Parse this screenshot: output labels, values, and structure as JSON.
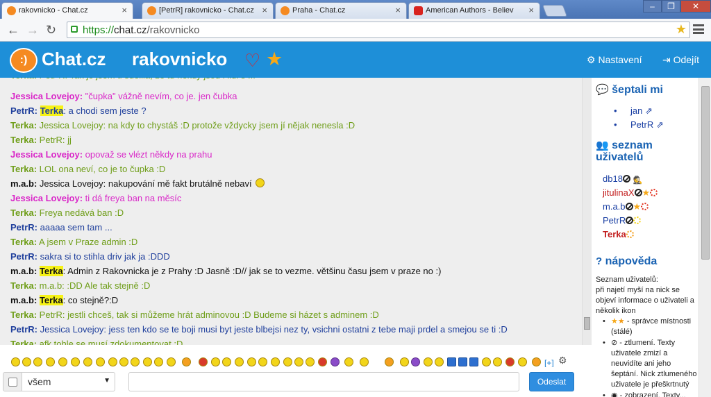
{
  "browser": {
    "tabs": [
      {
        "title": "rakovnicko - Chat.cz",
        "active": true,
        "icon": "chat-favicon"
      },
      {
        "title": "[PetrR] rakovnicko - Chat.cz",
        "active": false,
        "icon": "chat-favicon"
      },
      {
        "title": "Praha - Chat.cz",
        "active": false,
        "icon": "chat-favicon"
      },
      {
        "title": "American Authors - Believ",
        "active": false,
        "icon": "youtube-favicon"
      }
    ],
    "url_scheme": "https://",
    "url_host": "chat.cz",
    "url_path": "/rakovnicko"
  },
  "header": {
    "logo_text": "Chat.cz",
    "room_title": "rakovnicko",
    "settings_label": "Nastavení",
    "logout_label": "Odejít",
    "brand_color": "#1e8fd8"
  },
  "messages": [
    {
      "nick": "Terka:",
      "text": " Petr R: Tak je jsem ti sdělila, že tu někdy jsou i lidi s ... ",
      "color": "green",
      "partial": true
    },
    {
      "nick": "Jessica Lovejoy:",
      "text": " \"čupka\" vážně nevím, co je. jen čubka",
      "color": "pink"
    },
    {
      "nick": "PetrR:",
      "tag": "Terka",
      "text": ": a chodi sem jeste ?",
      "color": "blue"
    },
    {
      "nick": "Terka:",
      "text": " Jessica Lovejoy: na kdy to chystáš :D protože vždycky jsem jí nějak nenesla :D",
      "color": "green"
    },
    {
      "nick": "Terka:",
      "text": " PetrR: jj",
      "color": "green"
    },
    {
      "nick": "Jessica Lovejoy:",
      "text": " opovaž se vlézt někdy na prahu",
      "color": "pink"
    },
    {
      "nick": "Terka:",
      "text": " LOL ona neví, co je to čupka :D",
      "color": "green"
    },
    {
      "nick": "m.a.b:",
      "text": " Jessica Lovejoy: nakupování mě fakt brutálně nebaví ",
      "color": "black",
      "smiley": true
    },
    {
      "nick": "Jessica Lovejoy:",
      "text": " ti dá freya ban na měsíc",
      "color": "pink"
    },
    {
      "nick": "Terka:",
      "text": " Freya nedává ban :D",
      "color": "green"
    },
    {
      "nick": "PetrR:",
      "text": " aaaaa sem tam ...",
      "color": "blue"
    },
    {
      "nick": "Terka:",
      "text": " A jsem v Praze admin :D",
      "color": "green"
    },
    {
      "nick": "PetrR:",
      "text": " sakra si to stihla driv jak ja :DDD",
      "color": "blue"
    },
    {
      "nick": "m.a.b:",
      "tag": "Terka",
      "text": ": Admin z Rakovnicka je z Prahy :D Jasně :D// jak se to vezme. většinu času jsem v praze no :)",
      "color": "black"
    },
    {
      "nick": "Terka:",
      "text": " m.a.b: :DD Ale tak stejně :D",
      "color": "green"
    },
    {
      "nick": "m.a.b:",
      "tag": "Terka",
      "text": ": co stejně?:D",
      "color": "black"
    },
    {
      "nick": "Terka:",
      "text": " PetrR: jestli chceš, tak si můžeme hrát adminovou :D Budeme si házet s adminem :D",
      "color": "green"
    },
    {
      "nick": "PetrR:",
      "text": " Jessica Lovejoy: jess ten kdo se te boji musi byt jeste blbejsi nez ty, vsichni ostatni z tebe maji prdel a smejou se ti :D",
      "color": "blue"
    },
    {
      "nick": "Terka:",
      "text": " afk tohle se musí zdokumentovat :D",
      "color": "green"
    }
  ],
  "whispers": {
    "title": "šeptali mi",
    "users": [
      "jan",
      "PetrR"
    ]
  },
  "userlist": {
    "title_line1": "seznam",
    "title_line2": "uživatelů",
    "users": [
      {
        "name": "db18",
        "color": "blue",
        "badges": [
          "ban-icon",
          "spy-icon"
        ]
      },
      {
        "name": "jitulinaX",
        "color": "red",
        "badges": [
          "ban-icon",
          "star-icon",
          "sun-icon"
        ]
      },
      {
        "name": "m.a.b",
        "color": "blue",
        "badges": [
          "ban-icon",
          "star-icon",
          "sun-icon"
        ]
      },
      {
        "name": "PetrR",
        "color": "blue",
        "badges": [
          "ban-icon",
          "sun-icon"
        ]
      },
      {
        "name": "Terka",
        "color": "red",
        "bold": true,
        "badges": [
          "sun-icon"
        ]
      }
    ]
  },
  "help": {
    "title": "nápověda",
    "intro": "Seznam uživatelů:",
    "intro2": "při najetí myší na nick se objeví informace o uživateli a několik ikon",
    "items": [
      "- správce místnosti (stálé)",
      "- ztlumení. Texty uživatele zmizí a neuvidíte ani jeho šeptání. Nick ztlumeného uživatele je přeškrtnutý",
      "- zobrazení. Texty..."
    ]
  },
  "smileybar": {
    "plus_label": "[+]"
  },
  "input": {
    "recipient": "všem",
    "message_value": "",
    "send_label": "Odeslat"
  },
  "colors": {
    "green": "#6f9e19",
    "pink": "#d927c8",
    "blue": "#1f3f9c",
    "black": "#111111",
    "highlight": "#f6f217"
  }
}
